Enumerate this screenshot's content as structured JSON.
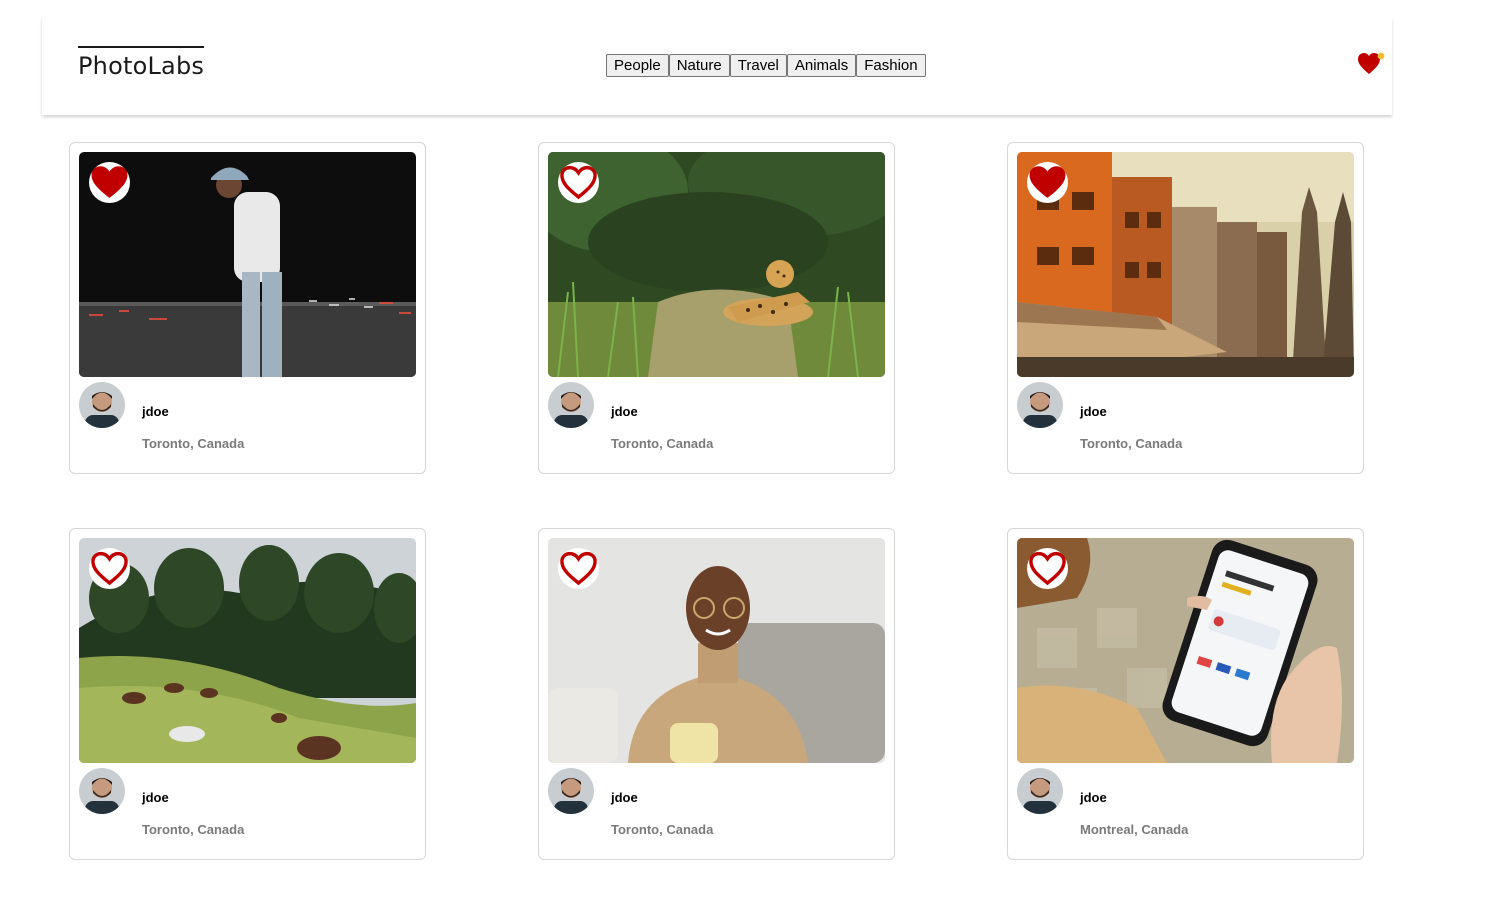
{
  "app": {
    "logo": "PhotoLabs"
  },
  "topics": [
    {
      "label": "People"
    },
    {
      "label": "Nature"
    },
    {
      "label": "Travel"
    },
    {
      "label": "Animals"
    },
    {
      "label": "Fashion"
    }
  ],
  "colors": {
    "heart": "#c00000",
    "notification": "#f0c030"
  },
  "photos": [
    {
      "username": "jdoe",
      "location": "Toronto, Canada",
      "favorited": true,
      "scene": "man-street-night"
    },
    {
      "username": "jdoe",
      "location": "Toronto, Canada",
      "favorited": false,
      "scene": "jaguar-grass"
    },
    {
      "username": "jdoe",
      "location": "Toronto, Canada",
      "favorited": true,
      "scene": "orange-buildings"
    },
    {
      "username": "jdoe",
      "location": "Toronto, Canada",
      "favorited": false,
      "scene": "horses-hillside"
    },
    {
      "username": "jdoe",
      "location": "Toronto, Canada",
      "favorited": false,
      "scene": "man-coffee-sofa"
    },
    {
      "username": "jdoe",
      "location": "Montreal, Canada",
      "favorited": false,
      "scene": "hand-phone"
    }
  ]
}
